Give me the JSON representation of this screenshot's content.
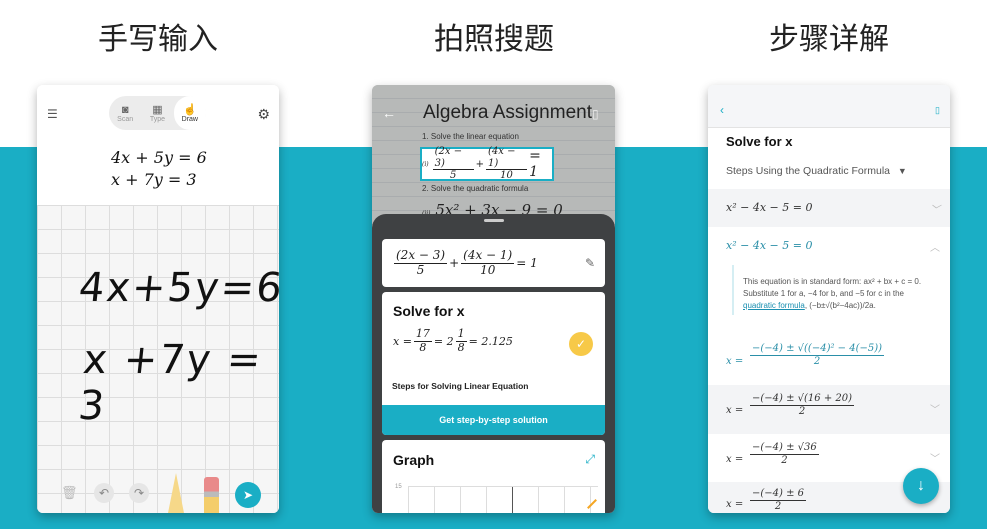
{
  "captions": [
    "手写输入",
    "拍照搜题",
    "步骤详解"
  ],
  "colors": {
    "accent": "#1aaec5",
    "check": "#f7c948",
    "sheet": "#3f4143"
  },
  "handwriting": {
    "modes": [
      {
        "label": "Scan",
        "icon": "camera-icon"
      },
      {
        "label": "Type",
        "icon": "keyboard-icon"
      },
      {
        "label": "Draw",
        "icon": "hand-draw-icon",
        "selected": true
      }
    ],
    "recognized": [
      "4x + 5y = 6",
      "x + 7y = 3"
    ],
    "handwritten": [
      "4x+5y=6",
      "x +7y = 3"
    ]
  },
  "scan": {
    "doc_title": "Algebra Assignment",
    "q1": "1. Solve the linear equation",
    "q1_label": "(i)",
    "q2": "2. Solve the quadratic formula",
    "q2_label": "(ii)",
    "q2_eq": "5x² + 3x − 9 = 0",
    "eq": {
      "n1": "(2x − 3)",
      "d1": "5",
      "n2": "(4x − 1)",
      "d2": "10",
      "plus": "+",
      "rhs": "= 1"
    },
    "solve_title": "Solve for x",
    "answer": {
      "lhs": "x =",
      "n1": "17",
      "d1": "8",
      "mid": "= 2",
      "n2": "1",
      "d2": "8",
      "rhs": "= 2.125"
    },
    "steps_label": "Steps for Solving Linear Equation",
    "cta": "Get step-by-step solution",
    "graph_title": "Graph",
    "graph_tick": "15"
  },
  "steps": {
    "title": "Solve for x",
    "method": "Steps Using the Quadratic Formula",
    "eq1": "x² − 4x − 5 = 0",
    "eq2": "x² − 4x − 5 = 0",
    "explain_pre": "This equation is in standard form: ax² + bx + c = 0. Substitute 1 for a, −4 for b, and −5 for c in the ",
    "explain_link": "quadratic formula",
    "explain_post": ", (−b±√(b²−4ac))/2a.",
    "s1": {
      "lhs": "x =",
      "num": "−(−4) ± √((−4)² − 4(−5))",
      "den": "2"
    },
    "s2": {
      "lhs": "x =",
      "num": "−(−4) ± √(16 + 20)",
      "den": "2"
    },
    "s3": {
      "lhs": "x =",
      "num": "−(−4) ± √36",
      "den": "2"
    },
    "s4": {
      "lhs": "x =",
      "num": "−(−4) ± 6",
      "den": "2"
    }
  }
}
